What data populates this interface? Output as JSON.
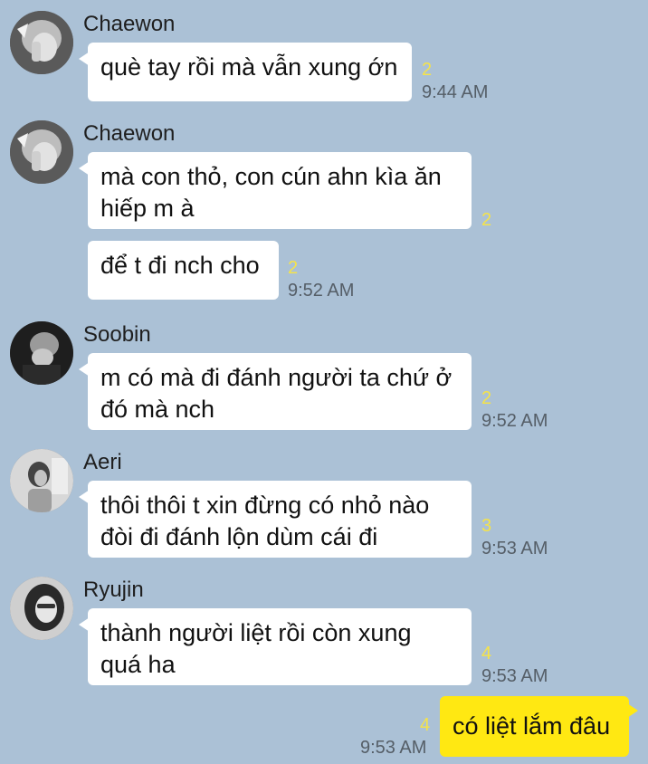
{
  "messages": [
    {
      "sender": "Chaewon",
      "text": "què tay rồi mà vẫn xung ớn",
      "unread": "2",
      "time": "9:44 AM"
    },
    {
      "sender": "Chaewon",
      "text": "mà con thỏ, con cún ahn kìa ăn\nhiếp m à",
      "unread": "2"
    },
    {
      "text": "để t đi nch cho",
      "unread": "2",
      "time": "9:52 AM"
    },
    {
      "sender": "Soobin",
      "text": "m có mà đi đánh người ta chứ ở\nđó mà nch",
      "unread": "2",
      "time": "9:52 AM"
    },
    {
      "sender": "Aeri",
      "text": "thôi thôi t xin đừng có nhỏ nào\nđòi đi đánh lộn dùm cái đi",
      "unread": "3",
      "time": "9:53 AM"
    },
    {
      "sender": "Ryujin",
      "text": "thành người liệt rồi còn xung\nquá ha",
      "unread": "4",
      "time": "9:53 AM"
    }
  ],
  "my_message": {
    "text": "có liệt lắm đâu",
    "unread": "4",
    "time": "9:53 AM"
  },
  "colors": {
    "background": "#abc1d6",
    "my_bubble": "#ffe812",
    "unread": "#f5e34a"
  }
}
